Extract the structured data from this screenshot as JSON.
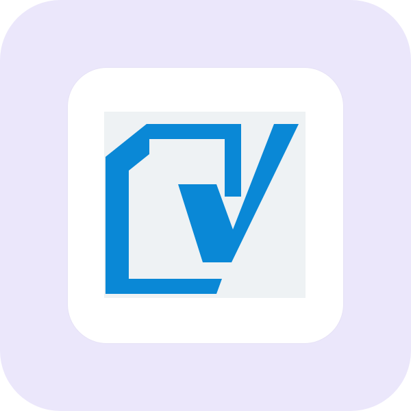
{
  "app_icon": {
    "name": "document-check-icon",
    "colors": {
      "outer_background": "#ebe7fb",
      "card_background": "#ffffff",
      "card_border": "#e6e2f6",
      "logo_background": "#eef2f4",
      "logo_blue": "#0a88d6"
    }
  }
}
